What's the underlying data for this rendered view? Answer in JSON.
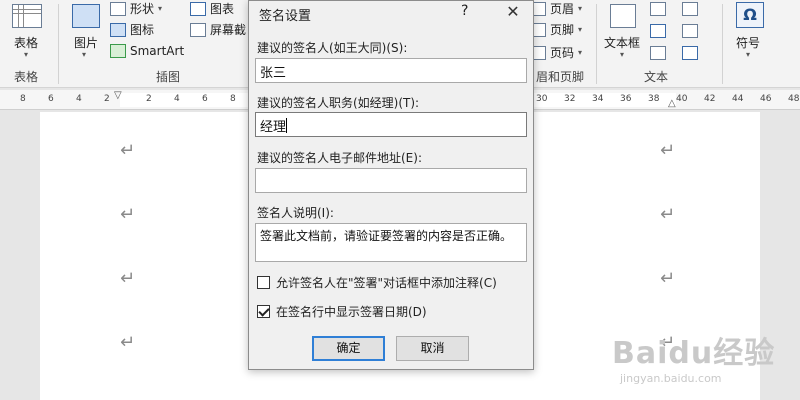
{
  "ribbon": {
    "groups": {
      "table_label": "表格",
      "illustrations_label": "插图",
      "header_footer_label": "眉和页脚",
      "text_label": "文本"
    },
    "table_button": "表格",
    "picture_button": "图片",
    "shapes": "形状",
    "icons": "图标",
    "smartart": "SmartArt",
    "chart": "图表",
    "screenshot": "屏幕截",
    "header": "页眉",
    "footer": "页脚",
    "page_number": "页码",
    "textbox": "文本框",
    "symbol": "符号",
    "symbol_glyph": "Ω"
  },
  "ruler": {
    "left_ticks": [
      "8",
      "6",
      "4",
      "2",
      "2",
      "4",
      "6",
      "8"
    ],
    "right_ticks": [
      "30",
      "32",
      "34",
      "36",
      "38",
      "40",
      "42",
      "44",
      "46",
      "48"
    ]
  },
  "document": {
    "paragraph_mark": "↵"
  },
  "dialog": {
    "title": "签名设置",
    "help": "?",
    "close": "✕",
    "signer_label": "建议的签名人(如王大同)(S):",
    "signer_value": "张三",
    "title_label": "建议的签名人职务(如经理)(T):",
    "title_value": "经理",
    "email_label": "建议的签名人电子邮件地址(E):",
    "email_value": "",
    "instructions_label": "签名人说明(I):",
    "instructions_value": "签署此文档前，请验证要签署的内容是否正确。",
    "allow_comments_label": "允许签名人在\"签署\"对话框中添加注释(C)",
    "allow_comments_checked": false,
    "show_date_label": "在签名行中显示签署日期(D)",
    "show_date_checked": true,
    "ok_label": "确定",
    "cancel_label": "取消"
  },
  "watermark": {
    "brand": "Baidu经验",
    "url": "jingyan.baidu.com"
  }
}
